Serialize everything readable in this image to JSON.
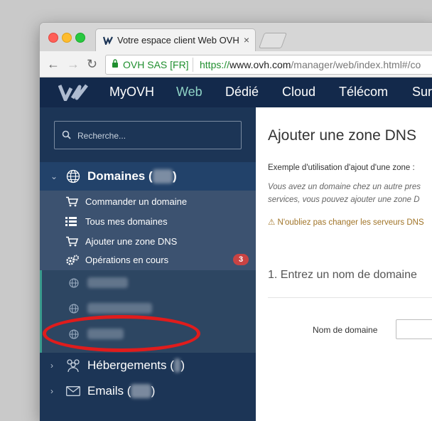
{
  "browser": {
    "tab_title": "Votre espace client Web OVH",
    "tab_close": "×",
    "secure_label": "OVH SAS [FR]",
    "url_scheme": "https://",
    "url_host": "www.ovh.com",
    "url_path": "/manager/web/index.html#/co"
  },
  "topnav": {
    "items": [
      "MyOVH",
      "Web",
      "Dédié",
      "Cloud",
      "Télécom",
      "Sur"
    ],
    "active": "Web",
    "background": "#13294b",
    "active_color": "#8fd3c6"
  },
  "sidebar": {
    "search_placeholder": "Recherche...",
    "domains_section": {
      "label": "Domaines",
      "count_open": " (",
      "count_close": ")",
      "expanded": true
    },
    "submenu": [
      {
        "label": "Commander un domaine",
        "icon": "cart-icon"
      },
      {
        "label": "Tous mes domaines",
        "icon": "list-icon"
      },
      {
        "label": "Ajouter une zone DNS",
        "icon": "cart-icon"
      },
      {
        "label": "Opérations en cours",
        "icon": "gears-icon",
        "badge": "3"
      }
    ],
    "domain_list": [
      {
        "name": "",
        "icon": "globe-icon"
      },
      {
        "name": "",
        "icon": "globe-icon"
      },
      {
        "name": "",
        "icon": "globe-icon"
      }
    ],
    "hosting_section": {
      "label": "Hébergements",
      "count_open": " (",
      "count_close": ")",
      "icon": "people-icon"
    },
    "emails_section": {
      "label": "Emails",
      "count_open": " (",
      "count_close": ")",
      "icon": "envelope-icon"
    }
  },
  "main": {
    "title": "Ajouter une zone DNS",
    "intro": "Exemple d'utilisation d'ajout d'une zone :",
    "description_line1": "Vous avez un domaine chez un autre pres",
    "description_line2": "services, vous pouvez ajouter une zone D",
    "warning": "N'oubliez pas changer les serveurs DNS",
    "step_title": "1. Entrez un nom de domaine",
    "field_label": "Nom de domaine",
    "field_value": ""
  }
}
